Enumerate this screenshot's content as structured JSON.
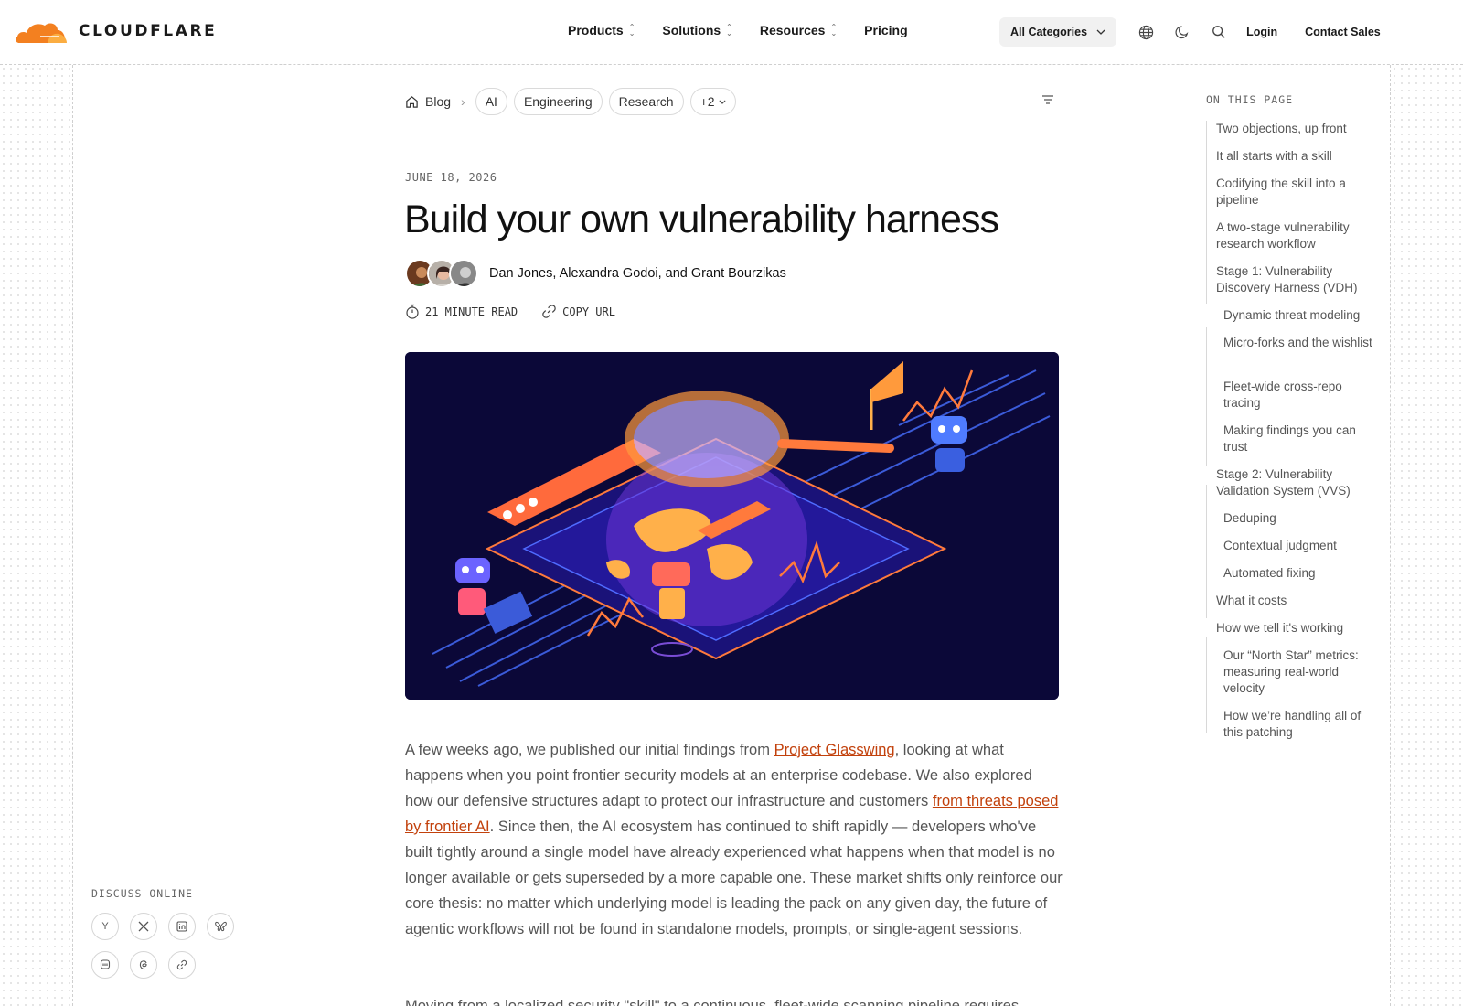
{
  "brand": {
    "name": "CLOUDFLARE",
    "accent": "#f38020"
  },
  "nav": {
    "items": [
      {
        "label": "Products",
        "dropdown": true
      },
      {
        "label": "Solutions",
        "dropdown": true
      },
      {
        "label": "Resources",
        "dropdown": true
      },
      {
        "label": "Pricing",
        "dropdown": false
      }
    ],
    "category_label": "All Categories",
    "login": "Login",
    "contact": "Contact Sales"
  },
  "breadcrumb": {
    "home": "Blog",
    "tags": [
      "AI",
      "Engineering",
      "Research"
    ],
    "more": "+2"
  },
  "article": {
    "date": "JUNE 18, 2026",
    "title": "Build your own vulnerability harness",
    "authors": {
      "a1": "Dan Jones",
      "a2": "Alexandra Godoi",
      "joiner": ", and ",
      "a3": "Grant Bourzikas"
    },
    "read_time": "21 MINUTE READ",
    "copy_url": "COPY URL",
    "p1": {
      "t1": "A few weeks ago, we published our initial findings from ",
      "l1": "Project Glasswing",
      "t2": ", looking at what happens when you point frontier security models at an enterprise codebase. We also explored how our defensive structures adapt to protect our infrastructure and customers ",
      "l2": "from threats posed by frontier AI",
      "t3": ". Since then, the AI ecosystem has continued to shift rapidly — developers who've built tightly around a single model have already experienced what happens when that model is no longer available or gets superseded by a more capable one. These market shifts only reinforce our core thesis: no matter which underlying model is leading the pack on any given day, the future of agentic workflows will not be found in standalone models, prompts, or single-agent sessions."
    },
    "p2": "Moving from a localized security \"skill\" to a continuous, fleet-wide scanning pipeline requires"
  },
  "toc": {
    "title": "ON THIS PAGE",
    "items": [
      {
        "label": "Two objections, up front",
        "level": 1
      },
      {
        "label": "It all starts with a skill",
        "level": 1
      },
      {
        "label": "Codifying the skill into a pipeline",
        "level": 1
      },
      {
        "label": "A two-stage vulnerability research workflow",
        "level": 1
      },
      {
        "label": "Stage 1: Vulnerability Discovery Harness (VDH)",
        "level": 1
      },
      {
        "label": "Dynamic threat modeling",
        "level": 2
      },
      {
        "label": "Micro-forks and the wishlist",
        "level": 2
      },
      {
        "label": "Fleet-wide cross-repo tracing",
        "level": 2
      },
      {
        "label": "Making findings you can trust",
        "level": 2
      },
      {
        "label": "Stage 2: Vulnerability Validation System (VVS)",
        "level": 1
      },
      {
        "label": "Deduping",
        "level": 2
      },
      {
        "label": "Contextual judgment",
        "level": 2
      },
      {
        "label": "Automated fixing",
        "level": 2
      },
      {
        "label": "What it costs",
        "level": 1
      },
      {
        "label": "How we tell it's working",
        "level": 1
      },
      {
        "label": "Our “North Star” metrics: measuring real-world velocity",
        "level": 2
      },
      {
        "label": "How we’re handling all of this patching",
        "level": 2
      }
    ]
  },
  "discuss": {
    "title": "DISCUSS ONLINE",
    "icons": [
      "hacker-news-icon",
      "x-icon",
      "linkedin-icon",
      "bluesky-icon",
      "mastodon-icon",
      "threads-icon",
      "link-icon"
    ],
    "hn_glyph": "Y"
  }
}
